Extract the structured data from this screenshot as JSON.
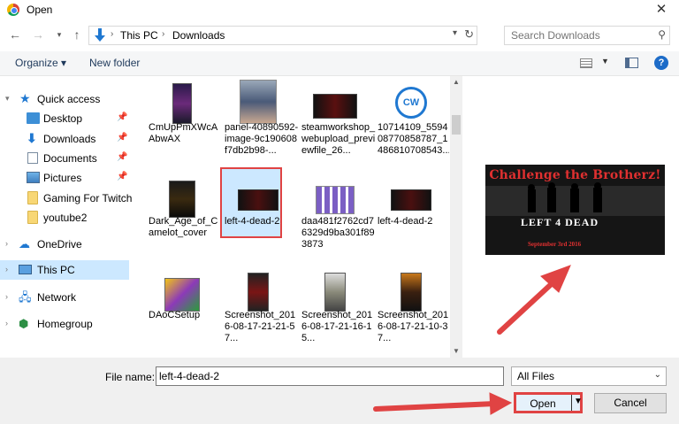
{
  "window": {
    "title": "Open",
    "close_glyph": "✕"
  },
  "address": {
    "path": [
      "This PC",
      "Downloads"
    ],
    "search_placeholder": "Search Downloads"
  },
  "toolbar": {
    "organize": "Organize ▾",
    "new_folder": "New folder",
    "help": "?"
  },
  "nav": [
    {
      "label": "Quick access",
      "icon": "star-icon",
      "expander": "▾",
      "pinned": false
    },
    {
      "label": "Desktop",
      "icon": "desktop-icon",
      "pinned": true
    },
    {
      "label": "Downloads",
      "icon": "downloads-icon",
      "pinned": true
    },
    {
      "label": "Documents",
      "icon": "documents-icon",
      "pinned": true
    },
    {
      "label": "Pictures",
      "icon": "pictures-icon",
      "pinned": true
    },
    {
      "label": "Gaming For Twitch",
      "icon": "folder-icon",
      "pinned": false
    },
    {
      "label": "youtube2",
      "icon": "folder-icon",
      "pinned": false
    },
    {
      "label": "OneDrive",
      "icon": "onedrive-icon",
      "expander": "›",
      "pinned": false
    },
    {
      "label": "This PC",
      "icon": "this-pc-icon",
      "expander": "›",
      "pinned": false,
      "selected": true
    },
    {
      "label": "Network",
      "icon": "network-icon",
      "expander": "›",
      "pinned": false
    },
    {
      "label": "Homegroup",
      "icon": "homegroup-icon",
      "expander": "›",
      "pinned": false
    }
  ],
  "files": [
    {
      "name": "CmUpPmXWcAAbwAX"
    },
    {
      "name": "panel-40890592-image-9c190608f7db2b98-..."
    },
    {
      "name": "steamworkshop_webupload_previewfile_26..."
    },
    {
      "name": "10714109_559408770858787_1486810708543..."
    },
    {
      "name": "Dark_Age_of_Camelot_cover"
    },
    {
      "name": "left-4-dead-2",
      "selected": true
    },
    {
      "name": "daa481f2762cd76329d9ba301f893873"
    },
    {
      "name": "left-4-dead-2"
    },
    {
      "name": "DAoCSetup"
    },
    {
      "name": "Screenshot_2016-08-17-21-21-57..."
    },
    {
      "name": "Screenshot_2016-08-17-21-16-15..."
    },
    {
      "name": "Screenshot_2016-08-17-21-10-37..."
    }
  ],
  "preview": {
    "title": "Challenge the Brotherz!",
    "logo": "LEFT 4 DEAD",
    "date": "September 3rd 2016"
  },
  "bottom": {
    "file_name_label": "File name:",
    "file_name_value": "left-4-dead-2",
    "file_type": "All Files",
    "open": "Open",
    "cancel": "Cancel"
  },
  "colors": {
    "selection": "#cce8ff",
    "annotation_red": "#e04343",
    "accent": "#1f78d1"
  }
}
